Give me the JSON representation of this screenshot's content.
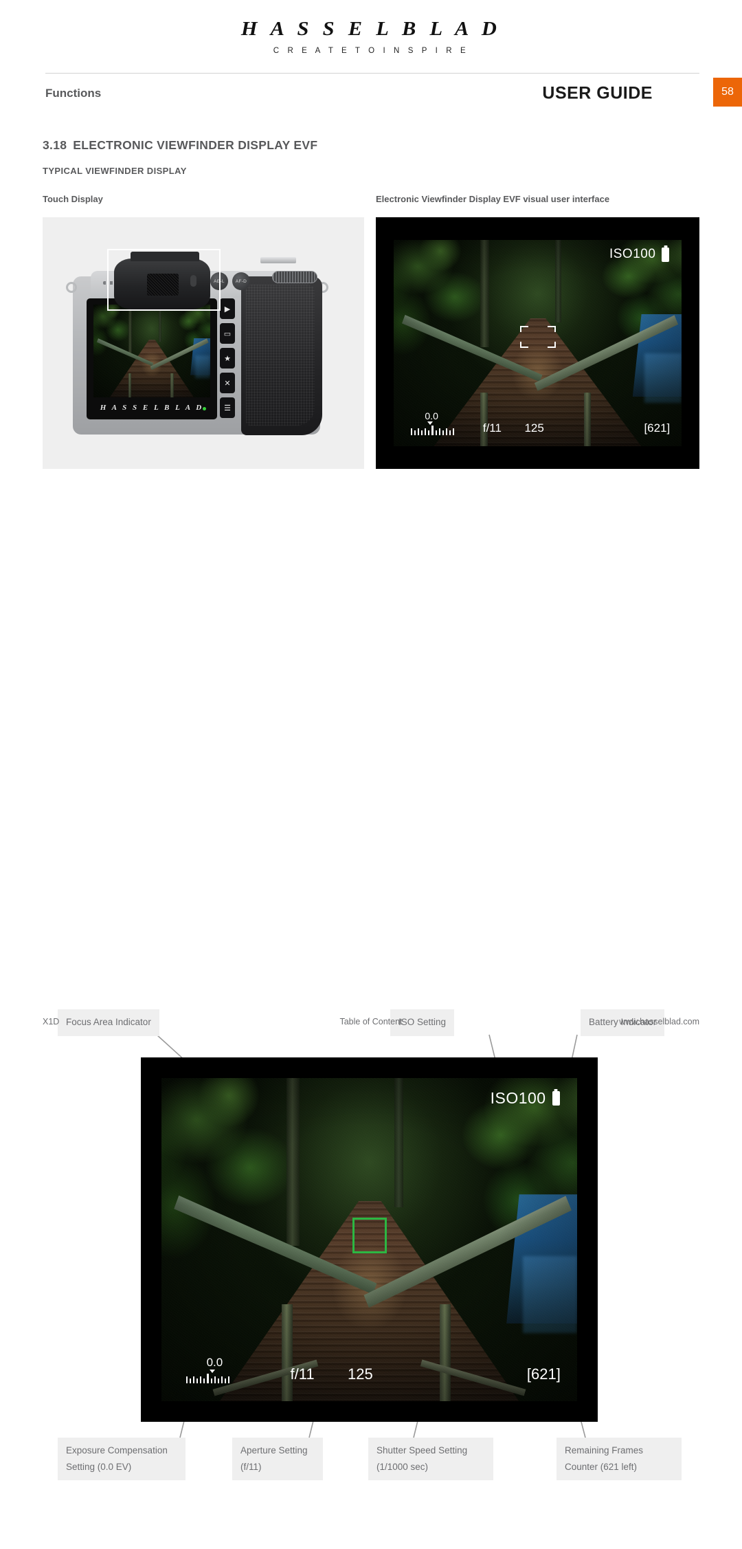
{
  "brand": {
    "name": "H A S S E L B L A D",
    "tagline": "C R E A T E   T O   I N S P I R E"
  },
  "header": {
    "left_title": "Functions",
    "right_title": "USER GUIDE",
    "page_number": "58",
    "badge_color": "#ec6608"
  },
  "section": {
    "number": "3.18",
    "title": "ELECTRONIC VIEWFINDER DISPLAY EVF",
    "subtitle": "TYPICAL VIEWFINDER DISPLAY"
  },
  "captions": {
    "touch_display": "Touch Display",
    "evf_interface": "Electronic Viewfinder Display EVF visual user interface"
  },
  "camera": {
    "screen_logo": "H A S S E L B L A D",
    "button_ael": "AE-L",
    "button_afd": "AF-D",
    "buttons": [
      "▶",
      "▭",
      "★",
      "✕",
      "☰"
    ]
  },
  "evf_hud": {
    "iso": "ISO100",
    "battery_icon": "battery-icon",
    "exposure_compensation": "0.0",
    "aperture": "f/11",
    "shutter_speed": "125",
    "frames_remaining": "[621]",
    "focus_box_color": "#2cb742"
  },
  "annotations": {
    "top": [
      {
        "label": "Focus Area Indicator"
      },
      {
        "label": "ISO Setting"
      },
      {
        "label": "Battery Indicator"
      }
    ],
    "bottom": [
      {
        "label": "Exposure Compensation\nSetting (0.0 EV)"
      },
      {
        "label": "Aperture Setting\n(f/11)"
      },
      {
        "label": "Shutter Speed Setting\n(1/1000 sec)"
      },
      {
        "label": "Remaining Frames\nCounter (621 left)"
      }
    ]
  },
  "footer": {
    "left": "X1D",
    "center": "Table of Content",
    "right": "www.hasselblad.com"
  }
}
